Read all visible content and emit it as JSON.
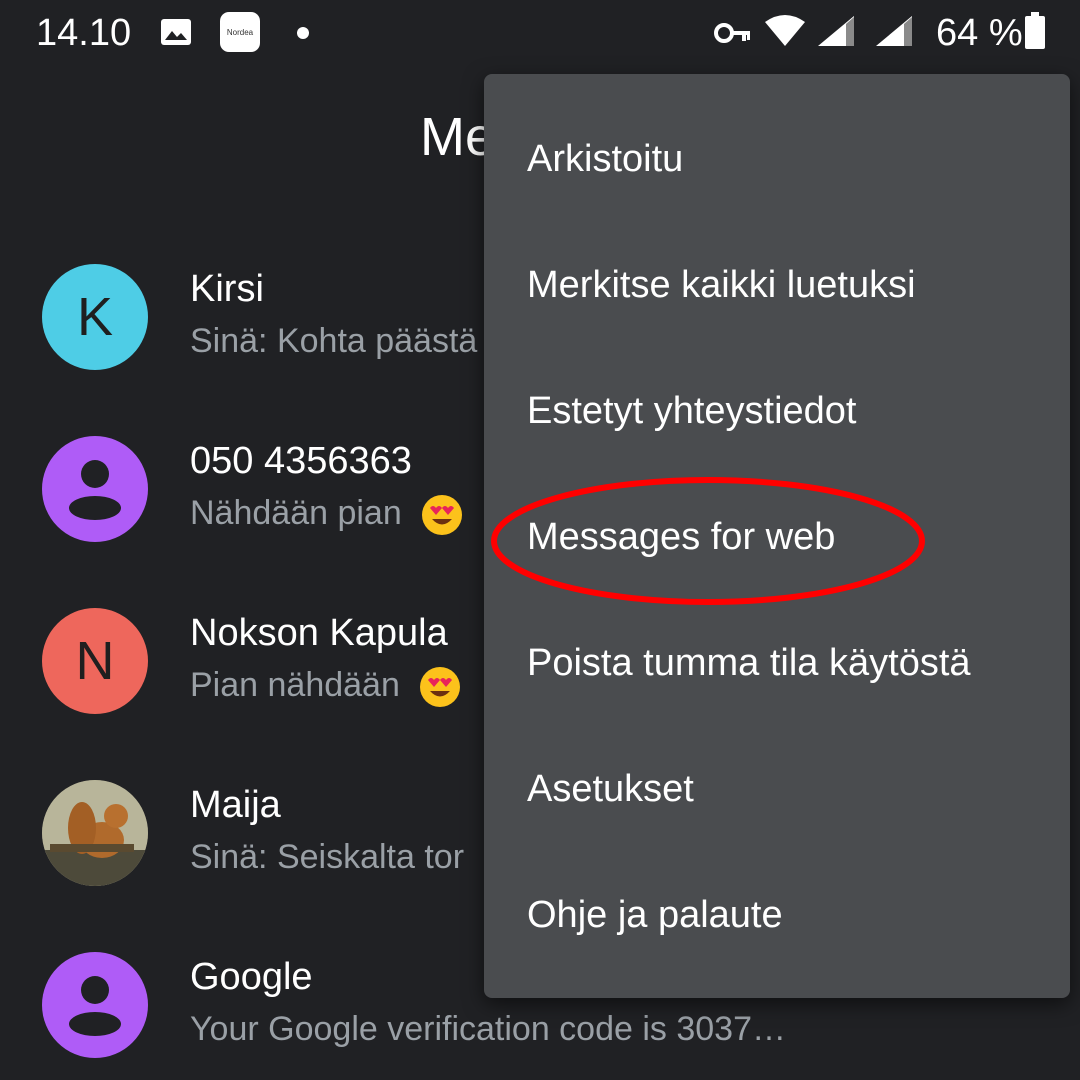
{
  "status_bar": {
    "time": "14.10",
    "notification_app_label": "Nordea",
    "battery_text": "64 %",
    "icons": [
      "image-icon",
      "nordea-app-icon",
      "dot-icon",
      "vpn-key-icon",
      "wifi-icon",
      "cell-signal-icon",
      "cell-signal-icon",
      "battery-icon"
    ]
  },
  "app_bar": {
    "title_visible_fragment": "Me"
  },
  "conversations": [
    {
      "avatar_letter": "K",
      "avatar_color": "#4ecde6",
      "name": "Kirsi",
      "snippet": "Sinä: Kohta päästä"
    },
    {
      "avatar_letter": "",
      "avatar_color": "#af5cf7",
      "avatar_icon": "person-icon",
      "name": "050 4356363",
      "snippet": "Nähdään pian",
      "emoji": "heart-eyes-emoji"
    },
    {
      "avatar_letter": "N",
      "avatar_color": "#ee675c",
      "name": "Nokson Kapula",
      "snippet": "Pian nähdään",
      "emoji": "heart-eyes-emoji"
    },
    {
      "avatar_letter": "",
      "avatar_icon": "squirrel-photo",
      "name": "Maija",
      "snippet": "Sinä: Seiskalta tor"
    },
    {
      "avatar_letter": "",
      "avatar_color": "#af5cf7",
      "avatar_icon": "person-icon",
      "name": "Google",
      "snippet": "Your Google verification code is 3037…"
    }
  ],
  "menu": {
    "items": [
      "Arkistoitu",
      "Merkitse kaikki luetuksi",
      "Estetyt yhteystiedot",
      "Messages for web",
      "Poista tumma tila käytöstä",
      "Asetukset",
      "Ohje ja palaute"
    ],
    "highlighted_item": "Messages for web",
    "highlight_color": "#ff0000",
    "background_color": "#4a4c4f"
  }
}
